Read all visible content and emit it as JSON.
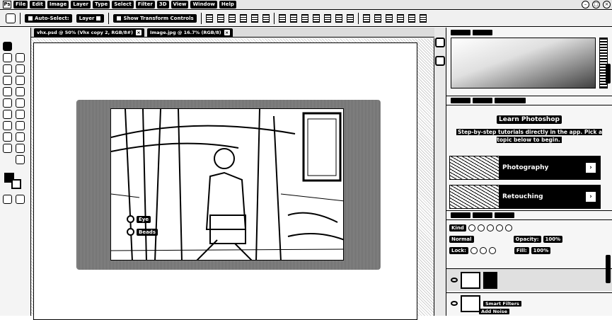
{
  "menubar": {
    "logo": "Ps",
    "items": [
      "File",
      "Edit",
      "Image",
      "Layer",
      "Type",
      "Select",
      "Filter",
      "3D",
      "View",
      "Window",
      "Help"
    ]
  },
  "options_bar": {
    "auto_select_label": "Auto-Select:",
    "layer_select_value": "Layer",
    "show_transform_label": "Show Transform Controls"
  },
  "document_tabs": [
    {
      "label": "vhx.psd @ 50% (Vhx copy 2, RGB/8#)",
      "active": true
    },
    {
      "label": "Image.jpg @ 16.7% (RGB/8)",
      "active": false
    }
  ],
  "canvas": {
    "annotations": [
      "Eye",
      "Beads"
    ]
  },
  "learn_panel": {
    "title": "Learn Photoshop",
    "subtitle": "Step-by-step tutorials directly in the app. Pick a topic below to begin.",
    "cards": [
      {
        "label": "Photography"
      },
      {
        "label": "Retouching"
      }
    ]
  },
  "layers_panel": {
    "kind_label": "Kind",
    "blend_mode": "Normal",
    "opacity_label": "Opacity:",
    "opacity_value": "100%",
    "lock_label": "Lock:",
    "fill_label": "Fill:",
    "fill_value": "100%",
    "smart_filters_label": "Smart Filters",
    "add_noise_label": "Add Noise"
  }
}
